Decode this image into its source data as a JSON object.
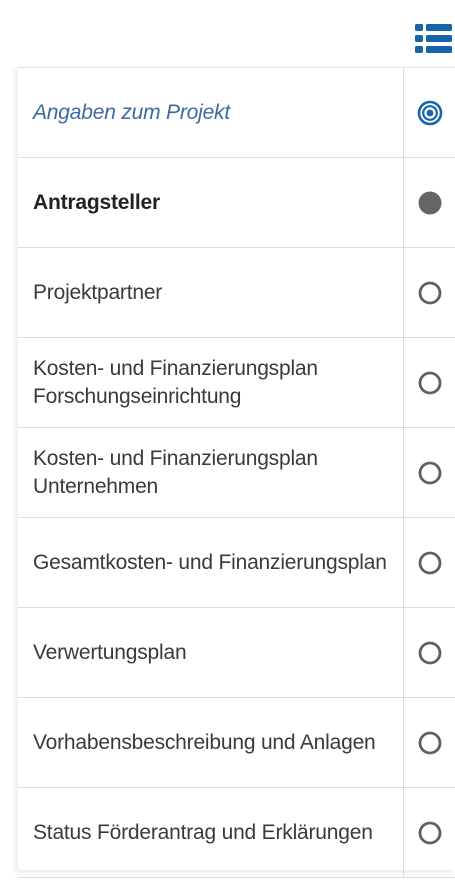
{
  "navigation": {
    "toggle_icon": "list-icon",
    "accent_color": "#1565a8"
  },
  "steps": [
    {
      "label": "Angaben zum Projekt",
      "state": "active",
      "status_icon": "target-icon"
    },
    {
      "label": "Antragsteller",
      "state": "current",
      "status_icon": "filled-circle-icon"
    },
    {
      "label": "Projektpartner",
      "state": "open",
      "status_icon": "empty-circle-icon"
    },
    {
      "label": "Kosten- und Finanzierungsplan Forschungseinrichtung",
      "state": "open",
      "status_icon": "empty-circle-icon"
    },
    {
      "label": "Kosten- und Finanzierungsplan Unternehmen",
      "state": "open",
      "status_icon": "empty-circle-icon"
    },
    {
      "label": "Gesamtkosten- und Finanzierungsplan",
      "state": "open",
      "status_icon": "empty-circle-icon"
    },
    {
      "label": "Verwertungsplan",
      "state": "open",
      "status_icon": "empty-circle-icon"
    },
    {
      "label": "Vorhabensbeschreibung und Anlagen",
      "state": "open",
      "status_icon": "empty-circle-icon"
    },
    {
      "label": "Status Förderantrag und Erklärungen",
      "state": "open",
      "status_icon": "empty-circle-icon"
    }
  ]
}
